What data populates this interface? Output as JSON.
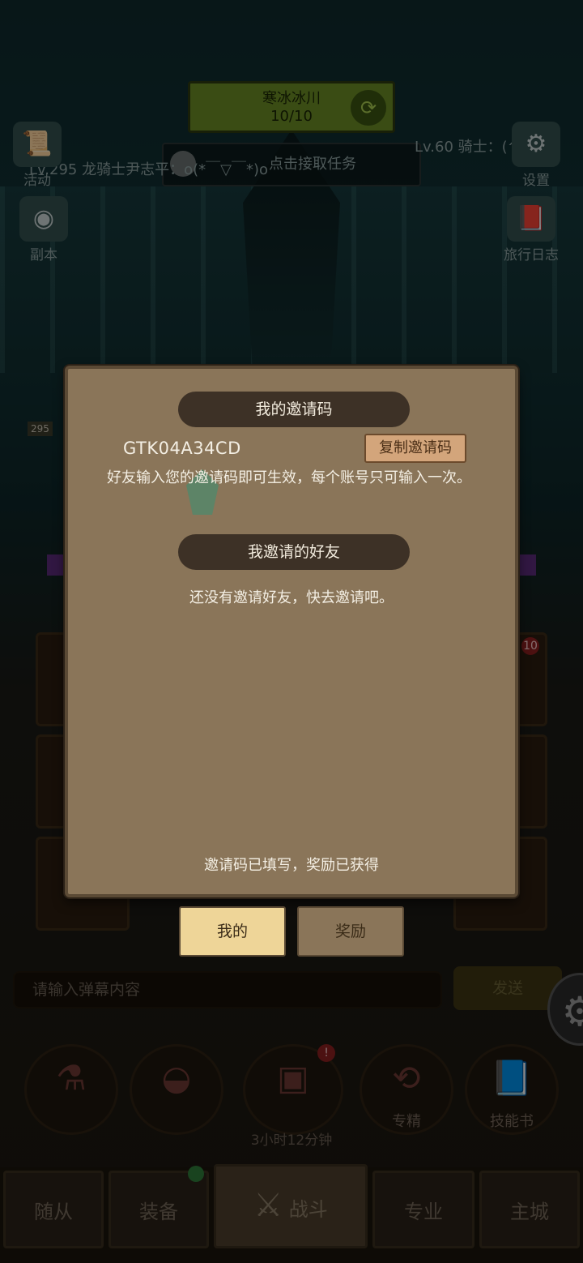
{
  "hud": {
    "region_name": "寒冰冰川",
    "region_progress": "10/10",
    "quest_label": "点击接取任务",
    "chat_line": "Lv.295 龙骑士尹志平：o(*￣▽￣*)o",
    "lv_line": "Lv.60 骑士：(^~^)",
    "activity_label": "活动",
    "settings_label": "设置",
    "dungeon_label": "副本",
    "journal_label": "旅行日志",
    "stage_tag": "295"
  },
  "invite_panel": {
    "my_code_title": "我的邀请码",
    "invite_code": "GTK04A34CD",
    "copy_button": "复制邀请码",
    "description": "好友输入您的邀请码即可生效，每个账号只可输入一次。",
    "invited_friends_title": "我邀请的好友",
    "empty_message": "还没有邀请好友，快去邀请吧。",
    "status_message": "邀请码已填写，奖励已获得",
    "tabs": [
      {
        "label": "我的",
        "active": true
      },
      {
        "label": "奖励",
        "active": false
      }
    ]
  },
  "bottom": {
    "danmaku_placeholder": "请输入弹幕内容",
    "send_button": "发送",
    "chest_timer": "3小时12分钟",
    "chest_badge": "!",
    "refine_label": "专精",
    "skillbook_label": "技能书",
    "slot_badge": "10"
  },
  "nav": {
    "tabs": [
      "随从",
      "装备",
      "战斗",
      "专业",
      "主城"
    ],
    "active": "战斗"
  },
  "colors": {
    "panel_bg": "#8a7559",
    "banner_bg": "#3d3126",
    "active_tab": "#eed598",
    "copy_button": "#d3a57b",
    "region_green": "#6a8b25"
  },
  "icons": {
    "refresh": "refresh-icon",
    "settings": "gear-icon",
    "dungeon": "portal-icon",
    "journal": "book-icon",
    "activity": "scroll-icon",
    "potion": "potion-icon",
    "bread": "bread-icon",
    "chest": "chest-icon",
    "refine": "refine-icon",
    "skillbook": "skillbook-icon",
    "battle": "crossed-swords-icon"
  }
}
